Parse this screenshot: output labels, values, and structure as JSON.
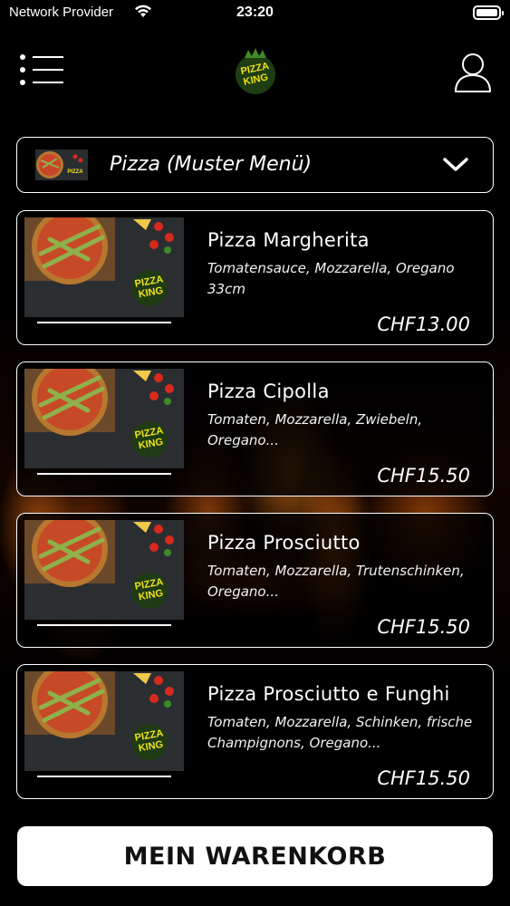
{
  "status_bar": {
    "carrier": "Network Provider",
    "time": "23:20"
  },
  "header": {
    "menu_icon": "menu-list-icon",
    "logo_text_line1": "PIZZA",
    "logo_text_line2": "KING",
    "user_icon": "user-icon"
  },
  "category": {
    "label": "Pizza (Muster Menü)",
    "icon": "chevron-down-icon"
  },
  "products": [
    {
      "name": "Pizza Margherita",
      "description": "Tomatensauce, Mozzarella, Oregano 33cm",
      "price": "CHF13.00"
    },
    {
      "name": "Pizza Cipolla",
      "description": "Tomaten, Mozzarella, Zwiebeln, Oregano...",
      "price": "CHF15.50"
    },
    {
      "name": "Pizza Prosciutto",
      "description": "Tomaten, Mozzarella, Trutenschinken, Oregano...",
      "price": "CHF15.50"
    },
    {
      "name": "Pizza Prosciutto e Funghi",
      "description": "Tomaten, Mozzarella, Schinken, frische Champignons, Oregano...",
      "price": "CHF15.50"
    }
  ],
  "cart_button": {
    "label": "MEIN WARENKORB"
  },
  "colors": {
    "background": "#000000",
    "brand_yellow": "#f2e21a",
    "brand_green": "#3f8a2a",
    "text": "#ffffff"
  }
}
